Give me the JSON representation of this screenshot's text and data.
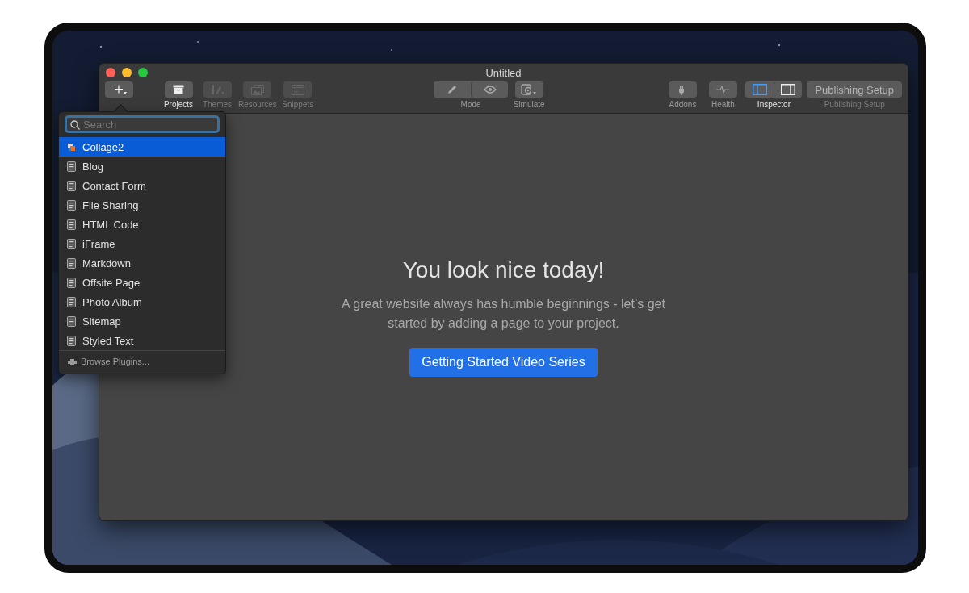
{
  "window": {
    "title": "Untitled"
  },
  "toolbar": {
    "add_button": {
      "kind": "add"
    },
    "left": [
      {
        "kind": "archive",
        "label": "Projects",
        "disabled": false
      },
      {
        "kind": "brush",
        "label": "Themes",
        "disabled": true
      },
      {
        "kind": "photos",
        "label": "Resources",
        "disabled": true
      },
      {
        "kind": "panel",
        "label": "Snippets",
        "disabled": true
      }
    ],
    "center": [
      {
        "kind": "mode",
        "label": "Mode",
        "disabled": false
      },
      {
        "kind": "preview",
        "label": "Simulate",
        "disabled": false
      }
    ],
    "right": [
      {
        "kind": "plug",
        "label": "Addons",
        "disabled": false
      },
      {
        "kind": "pulse",
        "label": "Health",
        "disabled": false
      },
      {
        "kind": "inspector",
        "label": "Inspector",
        "disabled": false,
        "segments": [
          {
            "kind": "sidebar-left",
            "selected": true
          },
          {
            "kind": "sidebar-right",
            "selected": false
          }
        ]
      },
      {
        "kind": "text",
        "label": "Publishing Setup",
        "button_text": "Publishing Setup",
        "disabled": true
      }
    ]
  },
  "add_menu": {
    "search": {
      "placeholder": "Search",
      "focused": true
    },
    "items": [
      {
        "label": "Collage2",
        "kind": "plugin",
        "selected": true
      },
      {
        "label": "Blog",
        "kind": "page",
        "selected": false
      },
      {
        "label": "Contact Form",
        "kind": "page",
        "selected": false
      },
      {
        "label": "File Sharing",
        "kind": "page",
        "selected": false
      },
      {
        "label": "HTML Code",
        "kind": "page",
        "selected": false
      },
      {
        "label": "iFrame",
        "kind": "page",
        "selected": false
      },
      {
        "label": "Markdown",
        "kind": "page",
        "selected": false
      },
      {
        "label": "Offsite Page",
        "kind": "page",
        "selected": false
      },
      {
        "label": "Photo Album",
        "kind": "page",
        "selected": false
      },
      {
        "label": "Sitemap",
        "kind": "page",
        "selected": false
      },
      {
        "label": "Styled Text",
        "kind": "page",
        "selected": false
      }
    ],
    "footer": "Browse Plugins..."
  },
  "empty_state": {
    "heading": "You look nice today!",
    "message": "A great website always has humble beginnings - let’s get started by adding a page to your project.",
    "button": "Getting Started Video Series"
  }
}
